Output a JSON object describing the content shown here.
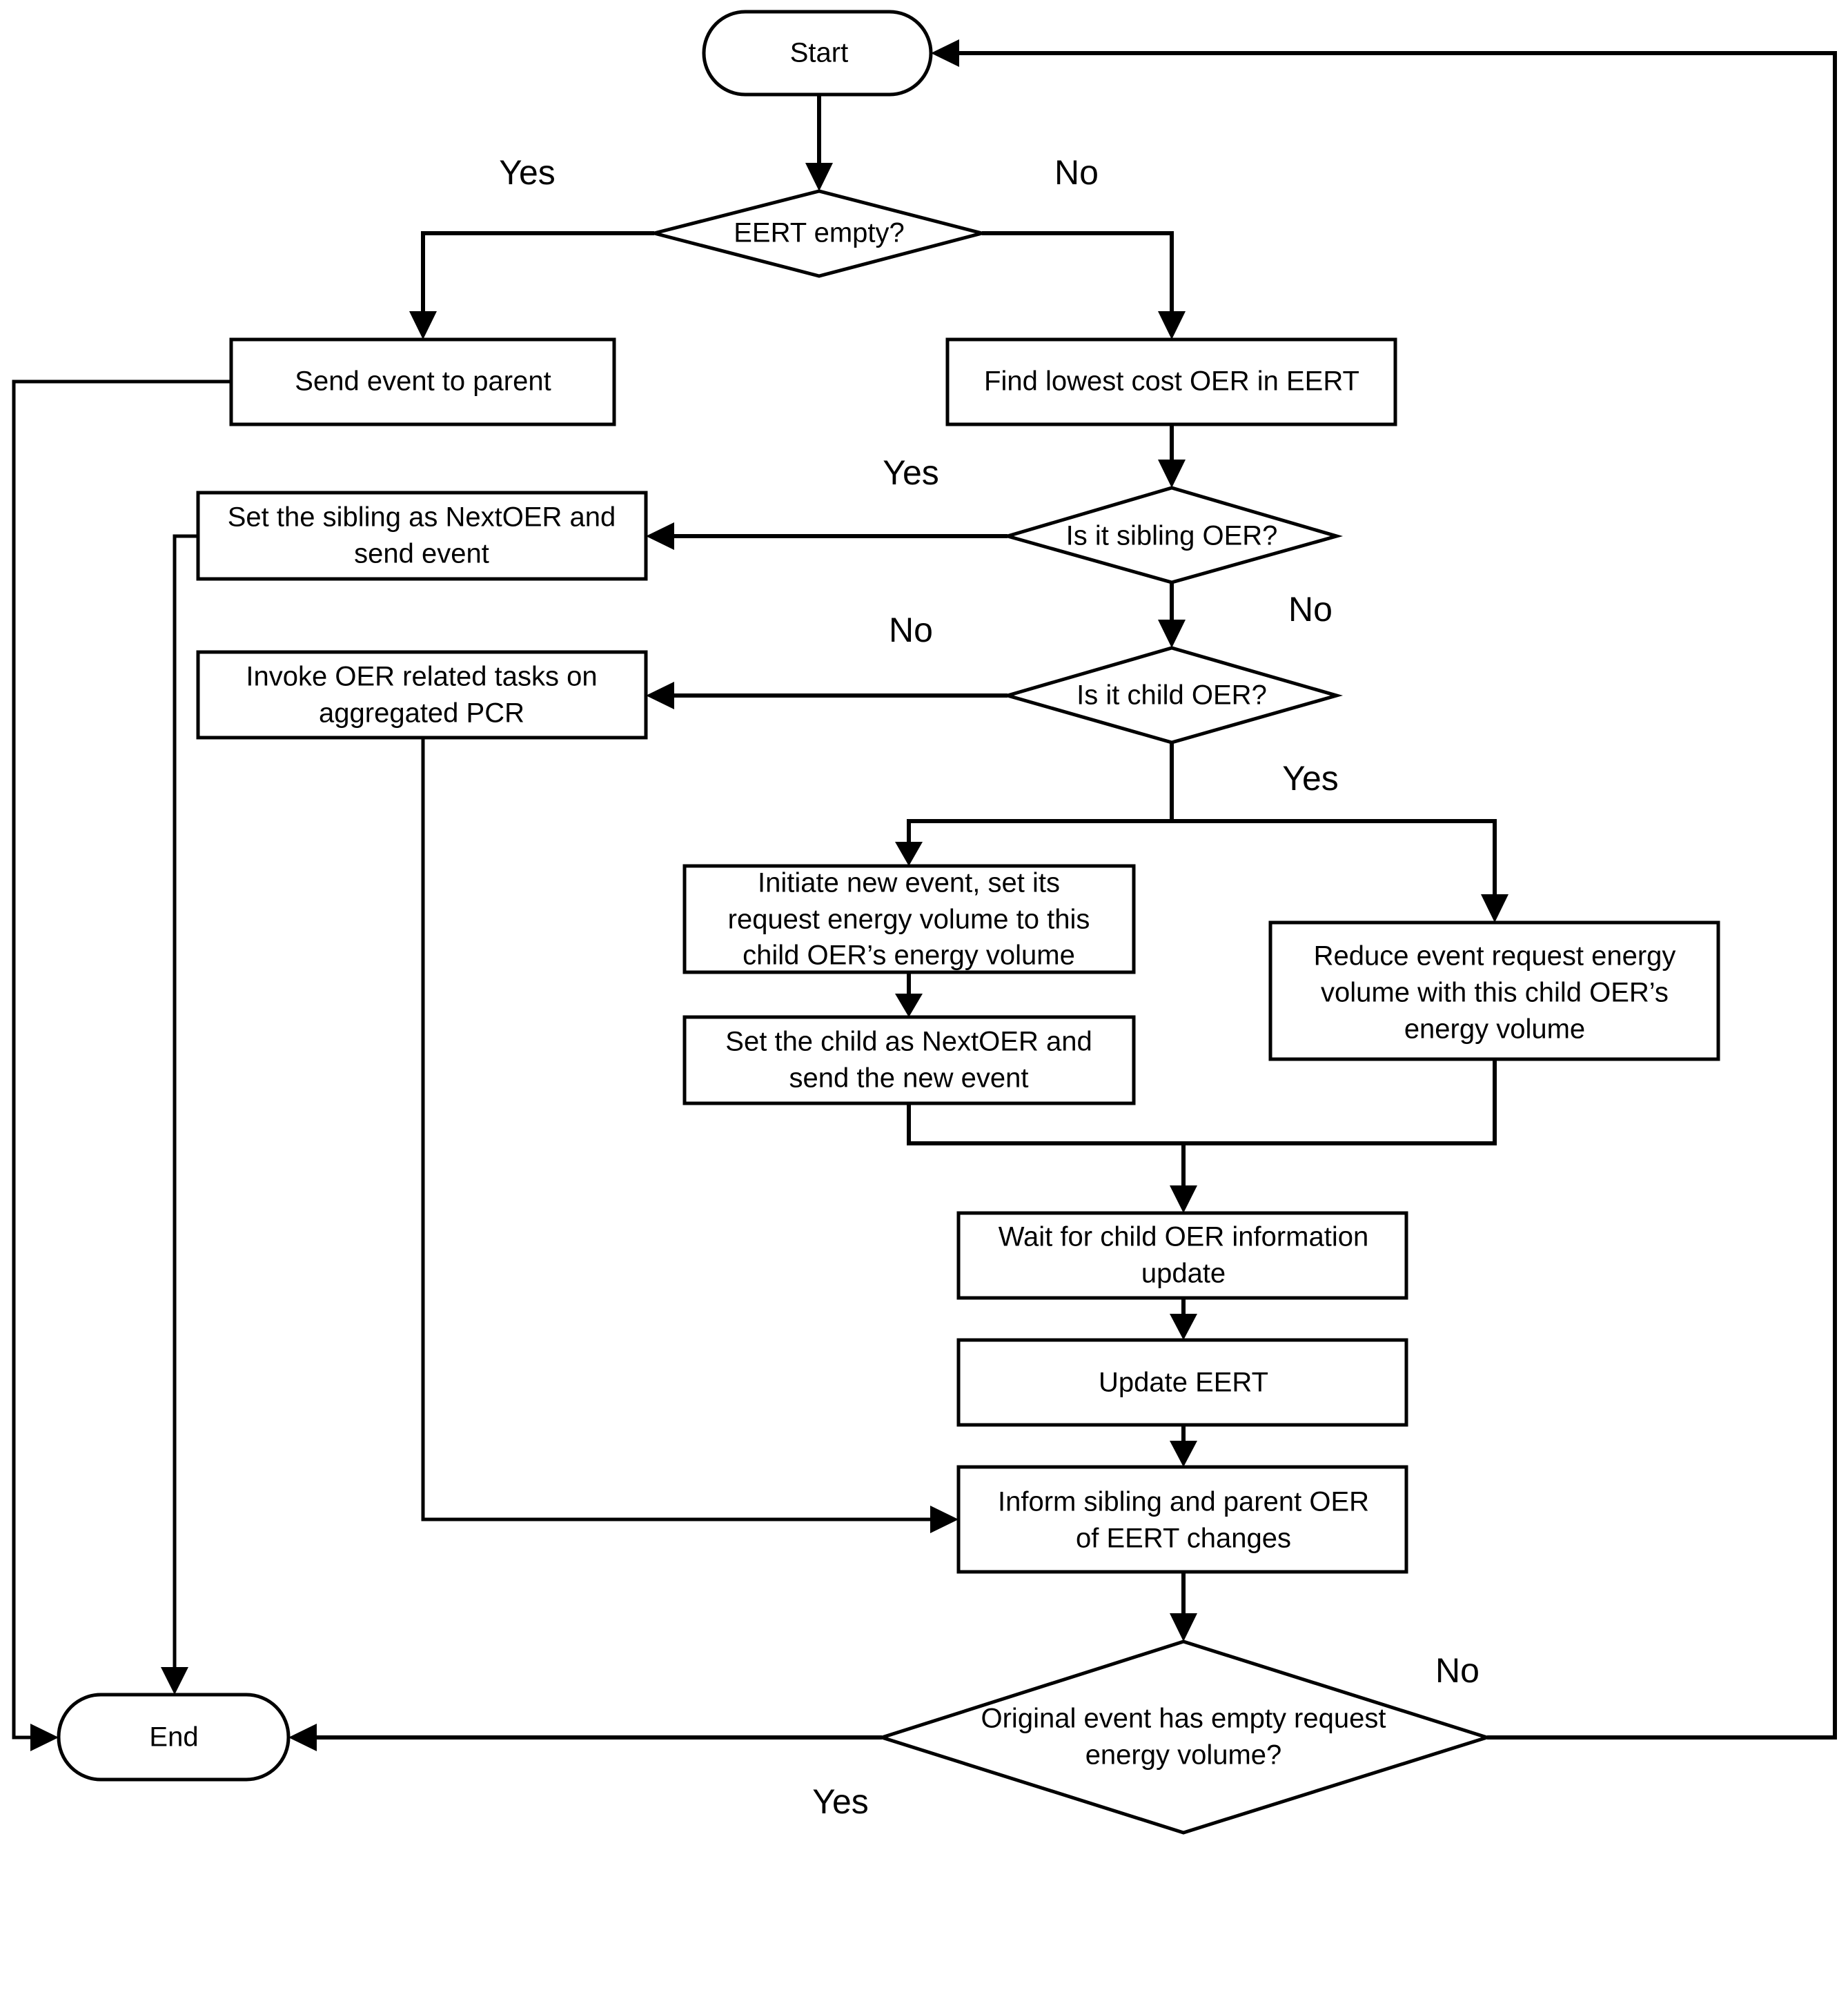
{
  "diagram": {
    "type": "flowchart",
    "nodes": {
      "start": {
        "shape": "terminal",
        "lines": [
          "Start"
        ]
      },
      "eert_empty": {
        "shape": "decision",
        "lines": [
          "EERT empty?"
        ]
      },
      "send_parent": {
        "shape": "process",
        "lines": [
          "Send event to parent"
        ]
      },
      "find_lowest": {
        "shape": "process",
        "lines": [
          "Find lowest cost OER in EERT"
        ]
      },
      "is_sibling": {
        "shape": "decision",
        "lines": [
          "Is it sibling OER?"
        ]
      },
      "set_sibling": {
        "shape": "process",
        "lines": [
          "Set the sibling as NextOER and",
          "send event"
        ]
      },
      "is_child": {
        "shape": "decision",
        "lines": [
          "Is it child OER?"
        ]
      },
      "invoke_tasks": {
        "shape": "process",
        "lines": [
          "Invoke OER related tasks on",
          "aggregated PCR"
        ]
      },
      "initiate_event": {
        "shape": "process",
        "lines": [
          "Initiate new event, set its",
          "request energy volume to this",
          "child OER’s energy volume"
        ]
      },
      "set_child": {
        "shape": "process",
        "lines": [
          "Set the child as NextOER and",
          "send the new event"
        ]
      },
      "reduce_volume": {
        "shape": "process",
        "lines": [
          "Reduce event request energy",
          "volume with this child OER’s",
          "energy volume"
        ]
      },
      "wait_update": {
        "shape": "process",
        "lines": [
          "Wait for child OER information",
          "update"
        ]
      },
      "update_eert": {
        "shape": "process",
        "lines": [
          "Update EERT"
        ]
      },
      "inform": {
        "shape": "process",
        "lines": [
          "Inform sibling and parent OER",
          "of EERT changes"
        ]
      },
      "original_empty": {
        "shape": "decision",
        "lines": [
          "Original event has empty request",
          "energy volume?"
        ]
      },
      "end": {
        "shape": "terminal",
        "lines": [
          "End"
        ]
      }
    },
    "edge_labels": {
      "eert_yes": "Yes",
      "eert_no": "No",
      "sibling_yes": "Yes",
      "sibling_no": "No",
      "child_no": "No",
      "child_yes": "Yes",
      "final_no": "No",
      "final_yes": "Yes"
    },
    "edges": [
      [
        "start",
        "eert_empty"
      ],
      [
        "eert_empty",
        "send_parent",
        "Yes"
      ],
      [
        "eert_empty",
        "find_lowest",
        "No"
      ],
      [
        "send_parent",
        "end"
      ],
      [
        "find_lowest",
        "is_sibling"
      ],
      [
        "is_sibling",
        "set_sibling",
        "Yes"
      ],
      [
        "is_sibling",
        "is_child",
        "No"
      ],
      [
        "set_sibling",
        "end"
      ],
      [
        "is_child",
        "invoke_tasks",
        "No"
      ],
      [
        "is_child",
        "initiate_event",
        "Yes"
      ],
      [
        "is_child",
        "reduce_volume",
        "Yes"
      ],
      [
        "initiate_event",
        "set_child"
      ],
      [
        "set_child",
        "wait_update"
      ],
      [
        "reduce_volume",
        "wait_update"
      ],
      [
        "wait_update",
        "update_eert"
      ],
      [
        "update_eert",
        "inform"
      ],
      [
        "invoke_tasks",
        "inform"
      ],
      [
        "inform",
        "original_empty"
      ],
      [
        "original_empty",
        "end",
        "Yes"
      ],
      [
        "original_empty",
        "start",
        "No"
      ]
    ]
  }
}
